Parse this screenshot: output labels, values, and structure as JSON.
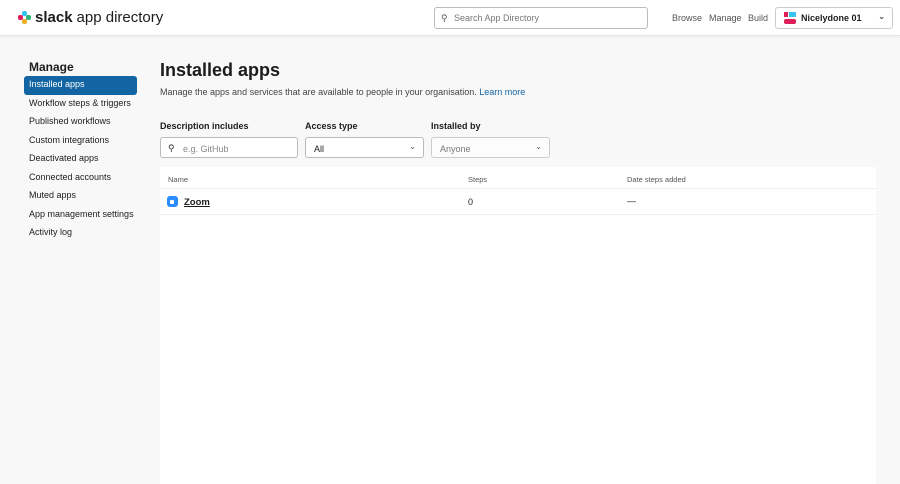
{
  "header": {
    "logo_bold": "slack",
    "logo_rest": "app directory",
    "search_placeholder": "Search App Directory",
    "nav": [
      "Browse",
      "Manage",
      "Build"
    ],
    "workspace": "Nicelydone 01"
  },
  "sidebar": {
    "title": "Manage",
    "items": [
      {
        "label": "Installed apps",
        "active": true
      },
      {
        "label": "Workflow steps & triggers"
      },
      {
        "label": "Published workflows"
      },
      {
        "label": "Custom integrations"
      },
      {
        "label": "Deactivated apps"
      },
      {
        "label": "Connected accounts"
      },
      {
        "label": "Muted apps"
      },
      {
        "label": "App management settings"
      },
      {
        "label": "Activity log"
      }
    ]
  },
  "main": {
    "title": "Installed apps",
    "subtitle": "Manage the apps and services that are available to people in your organisation.",
    "learn_more": "Learn more",
    "filters": {
      "description_label": "Description includes",
      "description_placeholder": "e.g. GitHub",
      "access_label": "Access type",
      "access_value": "All",
      "installed_label": "Installed by",
      "installed_value": "Anyone"
    },
    "table": {
      "columns": [
        "Name",
        "Steps",
        "Date steps added"
      ],
      "rows": [
        {
          "name": "Zoom",
          "steps": "0",
          "date": "—"
        }
      ]
    }
  },
  "colors": {
    "accent": "#1264a3",
    "zoom": "#2d8cff"
  }
}
